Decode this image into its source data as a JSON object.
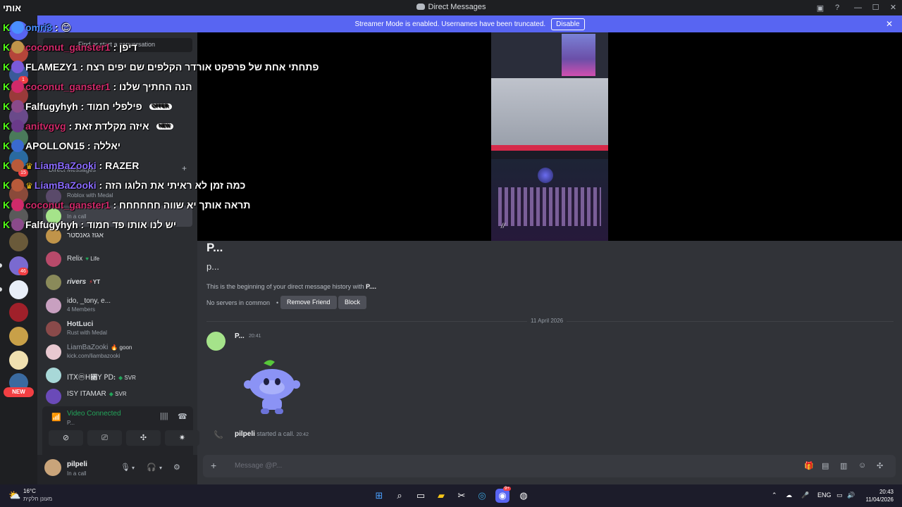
{
  "window": {
    "title": "Direct Messages",
    "minimize": "—",
    "maximize": "☐",
    "close": "✕"
  },
  "banner": {
    "text": "Streamer Mode is enabled. Usernames have been truncated.",
    "disable": "Disable",
    "close": "✕"
  },
  "rail": {
    "badges": [
      "1",
      "15",
      "5",
      "46"
    ],
    "new_label": "NEW"
  },
  "sidebar": {
    "search_placeholder": "Find or start a conversation",
    "dm_header": "Direct Messages",
    "dm_add": "+",
    "dms": [
      {
        "name": "Roblox with Medal",
        "sub": ""
      },
      {
        "name": "In a call",
        "sub": ""
      },
      {
        "name": "אגוז גאנסטר",
        "sub": ""
      },
      {
        "name": "Relix",
        "tag": "Life"
      },
      {
        "name": "rivers",
        "tag": "YT"
      },
      {
        "name": "ido, _tony, e...",
        "sub": "4 Members"
      },
      {
        "name": "HotLuci",
        "sub": "Rust with Medal"
      },
      {
        "name": "LiamBaZooki",
        "tag": "goon",
        "sub": "kick.com/liambazooki"
      },
      {
        "name": "ꓲꓔꓫⓜꓧ꓈ꓬ ꓑꓓꓽ",
        "tag": "SVR"
      },
      {
        "name": "ISY ITAMAR",
        "tag": "SVR"
      }
    ]
  },
  "voice": {
    "status": "Video Connected",
    "channel": "P...",
    "user_name": "pilpeli",
    "user_status": "In a call"
  },
  "profile": {
    "name": "P...",
    "handle": "p...",
    "begin_prefix": "This is the beginning of your direct message history with ",
    "begin_name": "P....",
    "servers": "No servers in common",
    "sep": "•",
    "remove_friend": "Remove Friend",
    "block": "Block"
  },
  "messages": {
    "date": "11 April 2026",
    "author": "P...",
    "time": "20:41",
    "call_user": "pilpeli",
    "call_text": " started a call.",
    "call_time": "20:42"
  },
  "composer": {
    "placeholder": "Message @P...",
    "plus": "+"
  },
  "overlay": {
    "title": "אותי",
    "lines": [
      {
        "name": "omri3",
        "msg": " : 😊",
        "name_color": "#4a90ff"
      },
      {
        "name": "coconut_ganster1",
        "msg": " : דיפן",
        "name_color": "#d02a6a"
      },
      {
        "name": "FLAMEZY1",
        "msg": " : פתחתי אחת של פרפקט אורדר הקלפים שם יפים רצח",
        "name_color": "#ffffff"
      },
      {
        "name": "coconut_ganster1",
        "msg": " : הנה החתיך שלנו",
        "name_color": "#d02a6a"
      },
      {
        "name": "Falfugyhyh",
        "msg": " : פילפלי חמוד",
        "name_color": "#ffffff",
        "badge": "OFFER"
      },
      {
        "name": "anitvgvg",
        "msg": " : איזה מקלדת זאת",
        "name_color": "#d02a6a",
        "badge": "NEW"
      },
      {
        "name": "APOLLON15",
        "msg": " : יאללה",
        "name_color": "#ffffff"
      },
      {
        "name": "LiamBaZooki",
        "msg": " : RAZER",
        "name_color": "#8a6bff"
      },
      {
        "name": "LiamBaZooki",
        "msg": " : כמה זמן לא ראיתי את הלוגו הזה",
        "name_color": "#8a6bff"
      },
      {
        "name": "coconut_ganster1",
        "msg": " : תראה אותך יא שווה חחחחחח",
        "name_color": "#d02a6a"
      },
      {
        "name": "Falfugyhyh",
        "msg": " : יש לנו אותו פד חמוד",
        "name_color": "#ffffff"
      }
    ]
  },
  "taskbar": {
    "temp": "16°C",
    "weather": "מעונן חלקית",
    "lang": "ENG",
    "time": "20:43",
    "date": "11/04/2026",
    "discord_badge": "9+"
  }
}
